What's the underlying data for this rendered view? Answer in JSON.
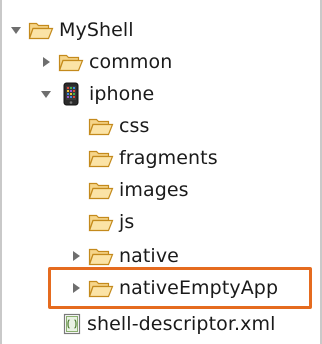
{
  "tree": {
    "root": {
      "label": "MyShell",
      "expanded": true,
      "icon": "folder-open-icon"
    },
    "items": [
      {
        "label": "common",
        "expanded": false,
        "icon": "folder-icon",
        "twisty": "collapsed"
      },
      {
        "label": "iphone",
        "expanded": true,
        "icon": "iphone-icon",
        "twisty": "expanded"
      },
      {
        "label": "css",
        "icon": "folder-icon",
        "twisty": "none"
      },
      {
        "label": "fragments",
        "icon": "folder-icon",
        "twisty": "none"
      },
      {
        "label": "images",
        "icon": "folder-icon",
        "twisty": "none"
      },
      {
        "label": "js",
        "icon": "folder-icon",
        "twisty": "none"
      },
      {
        "label": "native",
        "icon": "folder-icon",
        "twisty": "collapsed"
      },
      {
        "label": "nativeEmptyApp",
        "icon": "folder-icon",
        "twisty": "collapsed",
        "highlighted": true
      },
      {
        "label": "shell-descriptor.xml",
        "icon": "xml-file-icon",
        "twisty": "none"
      }
    ]
  },
  "colors": {
    "folder_fill": "#f6d58a",
    "folder_stroke": "#c48a1c",
    "highlight": "#e56b1f",
    "twisty": "#6e6e6e"
  }
}
